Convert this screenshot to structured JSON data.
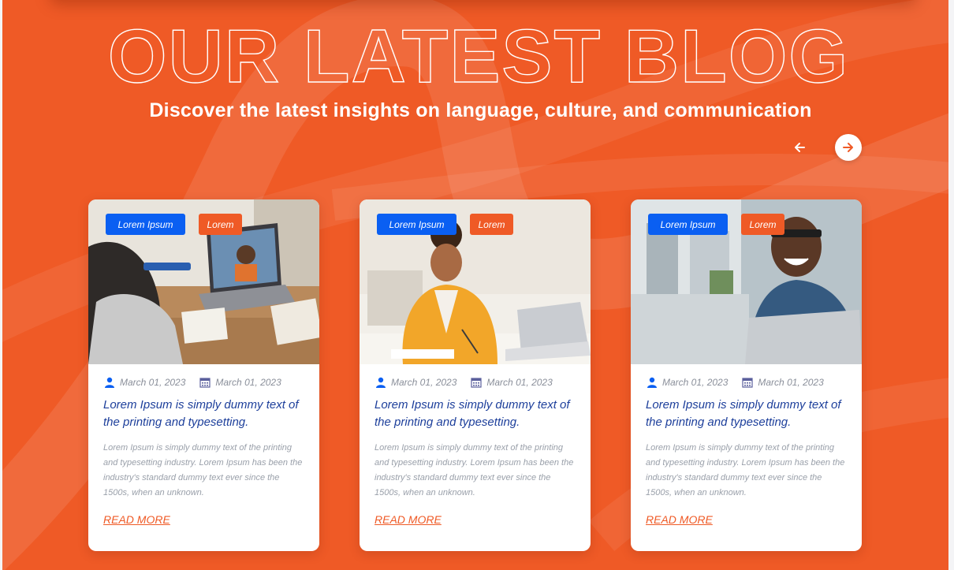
{
  "section": {
    "background_color": "#ef5a26",
    "heading": "OUR LATEST BLOG",
    "subheading": "Discover the latest insights on language, culture, and communication"
  },
  "carousel": {
    "prev_icon": "arrow-left-icon",
    "next_icon": "arrow-right-icon"
  },
  "colors": {
    "accent": "#ef5a26",
    "tag_primary": "#0a5ff2",
    "title_text": "#1d3f9b"
  },
  "posts": [
    {
      "image": "photo-girl-video-call",
      "tag_primary": "Lorem Ipsum",
      "tag_secondary": "Lorem",
      "author_icon": "user-icon",
      "author_meta": "March 01, 2023",
      "date_icon": "calendar-icon",
      "date": "March 01, 2023",
      "title": "Lorem Ipsum is simply dummy text of the printing and typesetting.",
      "excerpt": "Lorem Ipsum is simply dummy text of the printing and typesetting industry. Lorem Ipsum has been the industry's standard dummy text ever since the 1500s, when an unknown.",
      "read_more": "READ MORE"
    },
    {
      "image": "photo-woman-studying-laptop",
      "tag_primary": "Lorem Ipsum",
      "tag_secondary": "Lorem",
      "author_icon": "user-icon",
      "author_meta": "March 01, 2023",
      "date_icon": "calendar-icon",
      "date": "March 01, 2023",
      "title": "Lorem Ipsum is simply dummy text of the printing and typesetting.",
      "excerpt": "Lorem Ipsum is simply dummy text of the printing and typesetting industry. Lorem Ipsum has been the industry's standard dummy text ever since the 1500s, when an unknown.",
      "read_more": "READ MORE"
    },
    {
      "image": "photo-man-smiling-laptop",
      "tag_primary": "Lorem Ipsum",
      "tag_secondary": "Lorem",
      "author_icon": "user-icon",
      "author_meta": "March 01, 2023",
      "date_icon": "calendar-icon",
      "date": "March 01, 2023",
      "title": "Lorem Ipsum is simply dummy text of the printing and typesetting.",
      "excerpt": "Lorem Ipsum is simply dummy text of the printing and typesetting industry. Lorem Ipsum has been the industry's standard dummy text ever since the 1500s, when an unknown.",
      "read_more": "READ MORE"
    }
  ]
}
